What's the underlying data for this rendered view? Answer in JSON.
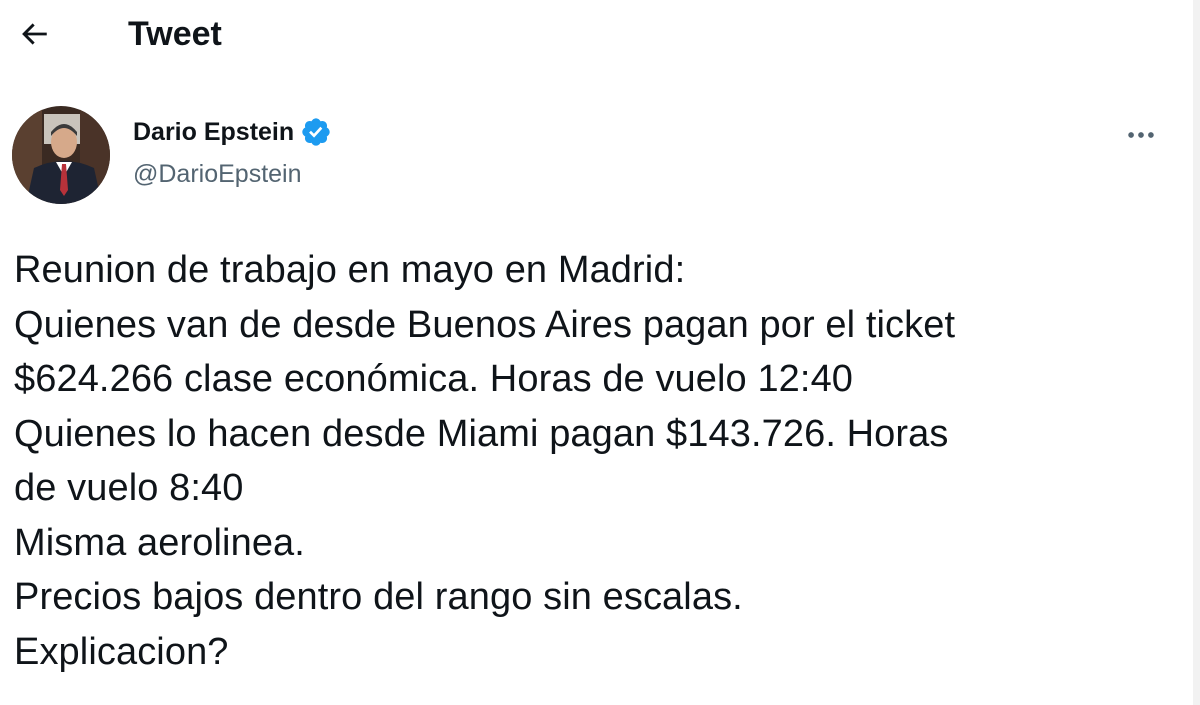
{
  "header": {
    "title": "Tweet",
    "back_icon": "arrow-left-icon"
  },
  "author": {
    "display_name": "Dario Epstein",
    "handle": "@DarioEpstein",
    "verified_icon": "verified-badge-icon",
    "avatar_icon": "avatar",
    "more_icon": "more-horizontal-icon"
  },
  "tweet": {
    "lines": [
      "Reunion de trabajo en mayo en Madrid:",
      "Quienes van de desde Buenos Aires pagan por el ticket",
      "$624.266 clase económica. Horas de vuelo 12:40",
      "Quienes lo hacen desde Miami pagan $143.726. Horas",
      "de vuelo 8:40",
      "Misma aerolinea.",
      "Precios bajos dentro del rango sin escalas.",
      "Explicacion?"
    ]
  },
  "colors": {
    "text_primary": "#0f1419",
    "text_secondary": "#536471",
    "verified_blue": "#1d9bf0"
  }
}
